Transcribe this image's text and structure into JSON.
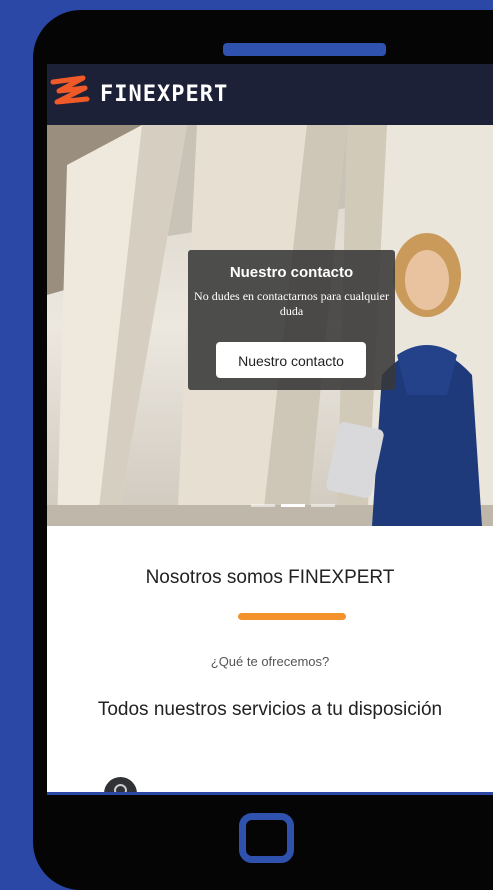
{
  "header": {
    "brand_name": "FINEXPERT",
    "logo_icon": "finexpert-logo-icon",
    "brand_color": "#f05a28"
  },
  "hero": {
    "title": "Nuestro contacto",
    "text": "No dudes en contactarnos para cualquier duda",
    "button_label": "Nuestro contacto",
    "slides_count_visible": 3,
    "active_slide": 1
  },
  "about": {
    "title": "Nosotros somos FINEXPERT",
    "accent_color": "#f4922c",
    "subtitle": "¿Qué te ofrecemos?",
    "services_title": "Todos nuestros servicios a tu disposición"
  },
  "device": {
    "frame_color": "#050505",
    "background_color": "#2b48a6"
  }
}
